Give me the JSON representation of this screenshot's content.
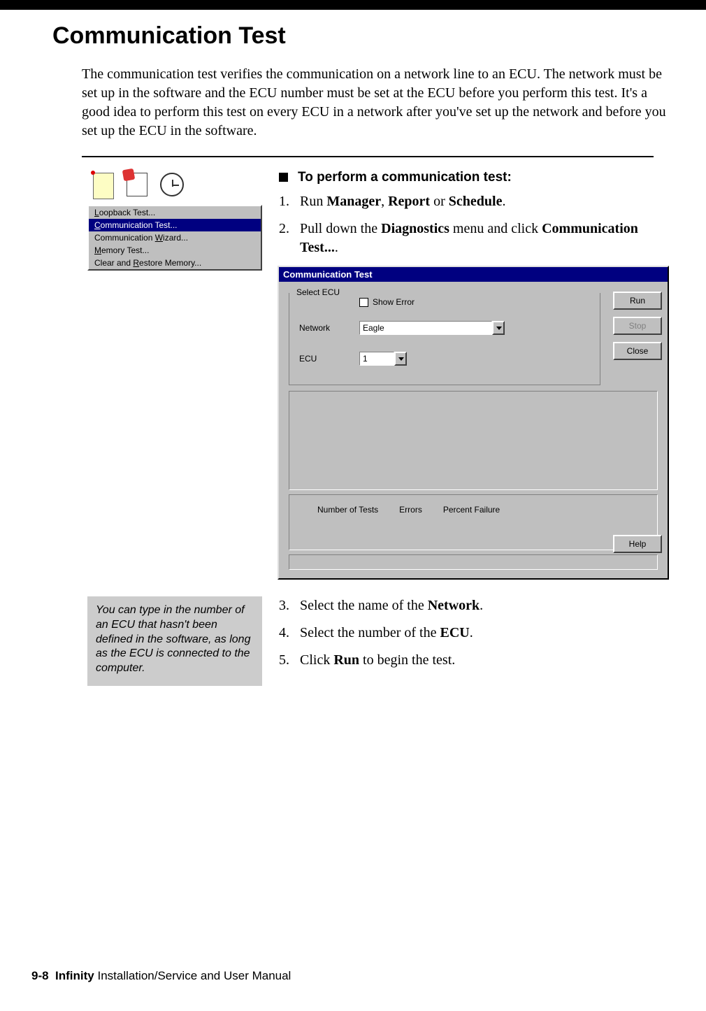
{
  "heading": "Communication Test",
  "intro": "The communication test verifies the communication on a network line to an ECU. The network must be set up in the software and the ECU number must be set at the ECU before you perform this test. It's a good idea to perform this test on every ECU in a network after you've set up the network and before you set up the ECU in the software.",
  "menu": {
    "items": [
      {
        "pre": "",
        "u": "L",
        "post": "oopback Test...",
        "selected": false
      },
      {
        "pre": "",
        "u": "C",
        "post": "ommunication Test...",
        "selected": true
      },
      {
        "pre": "Communication ",
        "u": "W",
        "post": "izard...",
        "selected": false
      },
      {
        "pre": "",
        "u": "M",
        "post": "emory Test...",
        "selected": false
      },
      {
        "pre": "Clear and ",
        "u": "R",
        "post": "estore Memory...",
        "selected": false
      }
    ]
  },
  "task_heading": "To perform a communication test:",
  "steps_top": {
    "s1": {
      "num": "1.",
      "pre": "Run ",
      "b1": "Manager",
      "mid1": ", ",
      "b2": "Report",
      "mid2": " or ",
      "b3": "Schedule",
      "post": "."
    },
    "s2": {
      "num": "2.",
      "pre": "Pull down the ",
      "b1": "Diagnostics",
      "mid1": " menu and click ",
      "b2": "Communication Test...",
      "post": "."
    }
  },
  "dialog": {
    "title": "Communication Test",
    "group_label": "Select ECU",
    "show_error": "Show Error",
    "network_label": "Network",
    "network_value": "Eagle",
    "ecu_label": "ECU",
    "ecu_value": "1",
    "buttons": {
      "run": "Run",
      "stop": "Stop",
      "close": "Close",
      "help": "Help"
    },
    "results": {
      "tests": "Number of Tests",
      "errors": "Errors",
      "pfail": "Percent Failure"
    }
  },
  "tip": "You can type in the number of an ECU that hasn't been defined in the software, as long as the ECU is connected to the computer.",
  "steps_bottom": {
    "s3": {
      "num": "3.",
      "pre": "Select the name of the ",
      "b1": "Network",
      "post": "."
    },
    "s4": {
      "num": "4.",
      "pre": "Select the number of the ",
      "b1": "ECU",
      "post": "."
    },
    "s5": {
      "num": "5.",
      "pre": "Click ",
      "b1": "Run",
      "post": " to begin the test."
    }
  },
  "footer": {
    "page": "9-8",
    "book": "Infinity",
    "rest": " Installation/Service and User Manual"
  }
}
